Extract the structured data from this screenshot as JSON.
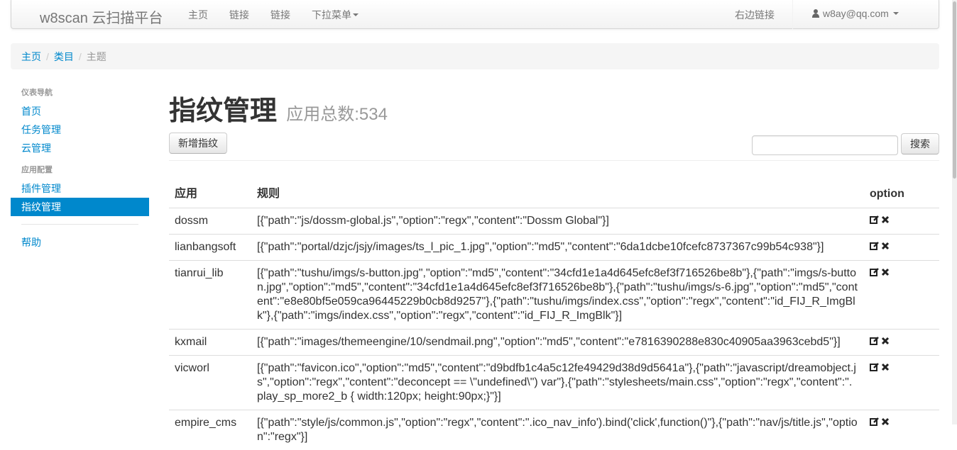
{
  "navbar": {
    "brand": "w8scan 云扫描平台",
    "links": [
      "主页",
      "链接",
      "链接"
    ],
    "dropdown": "下拉菜单",
    "right_link": "右边链接",
    "user": "w8ay@qq.com"
  },
  "breadcrumb": {
    "home": "主页",
    "category": "类目",
    "current": "主题"
  },
  "sidebar": {
    "header1": "仪表导航",
    "items1": [
      "首页",
      "任务管理",
      "云管理"
    ],
    "header2": "应用配置",
    "items2": [
      "插件管理",
      "指纹管理"
    ],
    "help": "帮助"
  },
  "main": {
    "title": "指纹管理",
    "subtitle": "应用总数:534",
    "add_button": "新增指纹",
    "search_value": "",
    "search_button": "搜索"
  },
  "table": {
    "headers": [
      "应用",
      "规则",
      "option"
    ],
    "rows": [
      {
        "app": "dossm",
        "rule": "[{\"path\":\"js/dossm-global.js\",\"option\":\"regx\",\"content\":\"Dossm Global\"}]"
      },
      {
        "app": "lianbangsoft",
        "rule": "[{\"path\":\"portal/dzjc/jsjy/images/ts_l_pic_1.jpg\",\"option\":\"md5\",\"content\":\"6da1dcbe10fcefc8737367c99b54c938\"}]"
      },
      {
        "app": "tianrui_lib",
        "rule": "[{\"path\":\"tushu/imgs/s-button.jpg\",\"option\":\"md5\",\"content\":\"34cfd1e1a4d645efc8ef3f716526be8b\"},{\"path\":\"imgs/s-button.jpg\",\"option\":\"md5\",\"content\":\"34cfd1e1a4d645efc8ef3f716526be8b\"},{\"path\":\"tushu/imgs/s-6.jpg\",\"option\":\"md5\",\"content\":\"e8e80bf5e059ca96445229b0cb8d9257\"},{\"path\":\"tushu/imgs/index.css\",\"option\":\"regx\",\"content\":\"id_FIJ_R_ImgBlk\"},{\"path\":\"imgs/index.css\",\"option\":\"regx\",\"content\":\"id_FIJ_R_ImgBlk\"}]"
      },
      {
        "app": "kxmail",
        "rule": "[{\"path\":\"images/themeengine/10/sendmail.png\",\"option\":\"md5\",\"content\":\"e7816390288e830c40905aa3963cebd5\"}]"
      },
      {
        "app": "vicworl",
        "rule": "[{\"path\":\"favicon.ico\",\"option\":\"md5\",\"content\":\"d9bdfb1c4a5c12fe49429d38d9d5641a\"},{\"path\":\"javascript/dreamobject.js\",\"option\":\"regx\",\"content\":\"deconcept == \\\"undefined\\\") var\"},{\"path\":\"stylesheets/main.css\",\"option\":\"regx\",\"content\":\".play_sp_more2_b { width:120px; height:90px;}\"}]"
      },
      {
        "app": "empire_cms",
        "rule": "[{\"path\":\"style/js/common.js\",\"option\":\"regx\",\"content\":\".ico_nav_info').bind('click',function()\"},{\"path\":\"nav/js/title.js\",\"option\":\"regx\"}]"
      }
    ]
  },
  "icons": {
    "edit": "edit-icon",
    "delete": "delete-icon"
  }
}
